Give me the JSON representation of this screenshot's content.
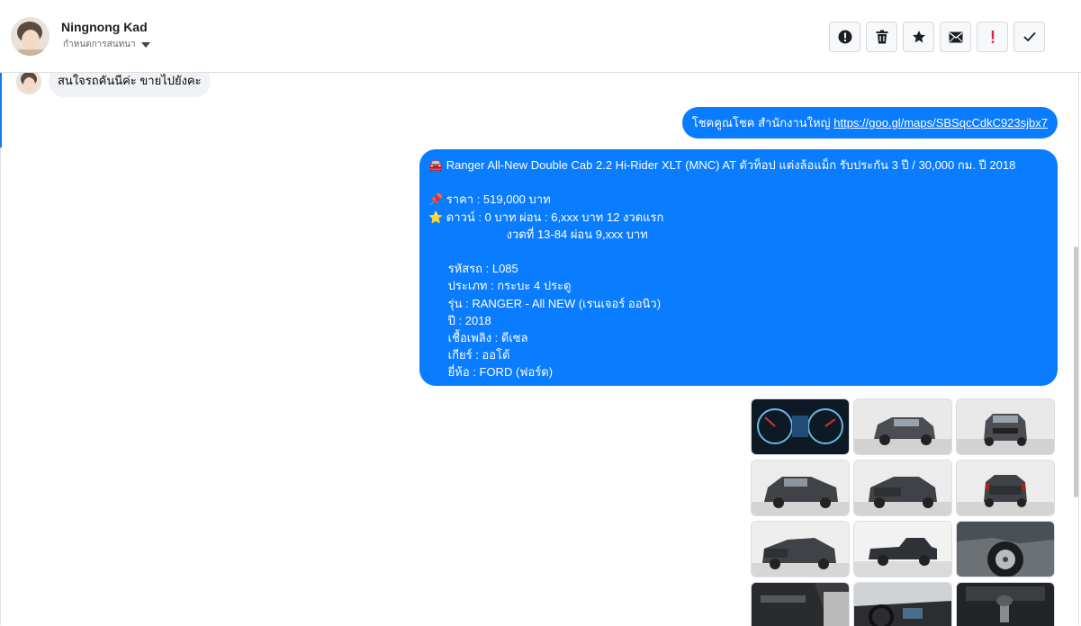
{
  "contact": {
    "name": "Ningnong Kad",
    "status_label": "กำหนดการสนทนา"
  },
  "toolbar": {
    "buttons": [
      {
        "name": "report-button",
        "icon": "alert-circle-icon"
      },
      {
        "name": "delete-button",
        "icon": "trash-icon"
      },
      {
        "name": "star-button",
        "icon": "star-icon"
      },
      {
        "name": "mark-unread-button",
        "icon": "envelope-icon"
      },
      {
        "name": "important-button",
        "icon": "exclamation-icon",
        "color": "#e41e3f"
      },
      {
        "name": "done-button",
        "icon": "check-icon"
      }
    ]
  },
  "messages": {
    "incoming_1": "สนใจรถคันนีค่ะ ขายไปยังคะ",
    "outgoing_1_prefix": "โชคคูณโชค สำนักงานใหญ่ ",
    "outgoing_1_link": "https://goo.gl/maps/SBSqcCdkC923sjbx7",
    "outgoing_2_lines": [
      "🚘 Ranger All-New Double Cab 2.2 Hi-Rider XLT (MNC) AT ตัวท็อป แต่งล้อแม็ก รับประกัน 3 ปี / 30,000 กม. ปี 2018",
      "",
      "📌 ราคา : 519,000 บาท",
      "⭐ ดาวน์ : 0 บาท ผ่อน : 6,xxx บาท 12 งวดแรก",
      "                        งวดที่ 13-84 ผ่อน 9,xxx บาท",
      "",
      "      รหัสรถ : L085",
      "      ประเภท : กระบะ 4 ประตู",
      "      รุ่น : RANGER - All NEW (เรนเจอร์ ออนิว)",
      "      ปี : 2018",
      "      เชื้อเพลิง : ดีเซล",
      "      เกียร์ : ออโต้",
      "      ยี่ห้อ : FORD (ฟอร์ด)"
    ]
  },
  "gallery": {
    "photos": [
      {
        "subject": "dashboard-gauges"
      },
      {
        "subject": "truck-front-angle"
      },
      {
        "subject": "truck-front"
      },
      {
        "subject": "truck-front-left"
      },
      {
        "subject": "truck-rear-angle"
      },
      {
        "subject": "truck-rear"
      },
      {
        "subject": "truck-rear-left"
      },
      {
        "subject": "truck-side"
      },
      {
        "subject": "wheel-closeup"
      },
      {
        "subject": "door-interior"
      },
      {
        "subject": "cabin-interior"
      },
      {
        "subject": "gear-shifter"
      }
    ]
  },
  "colors": {
    "outgoing_bubble": "#0a7cff",
    "incoming_bubble": "#f0f2f5",
    "accent": "#1877f2"
  }
}
